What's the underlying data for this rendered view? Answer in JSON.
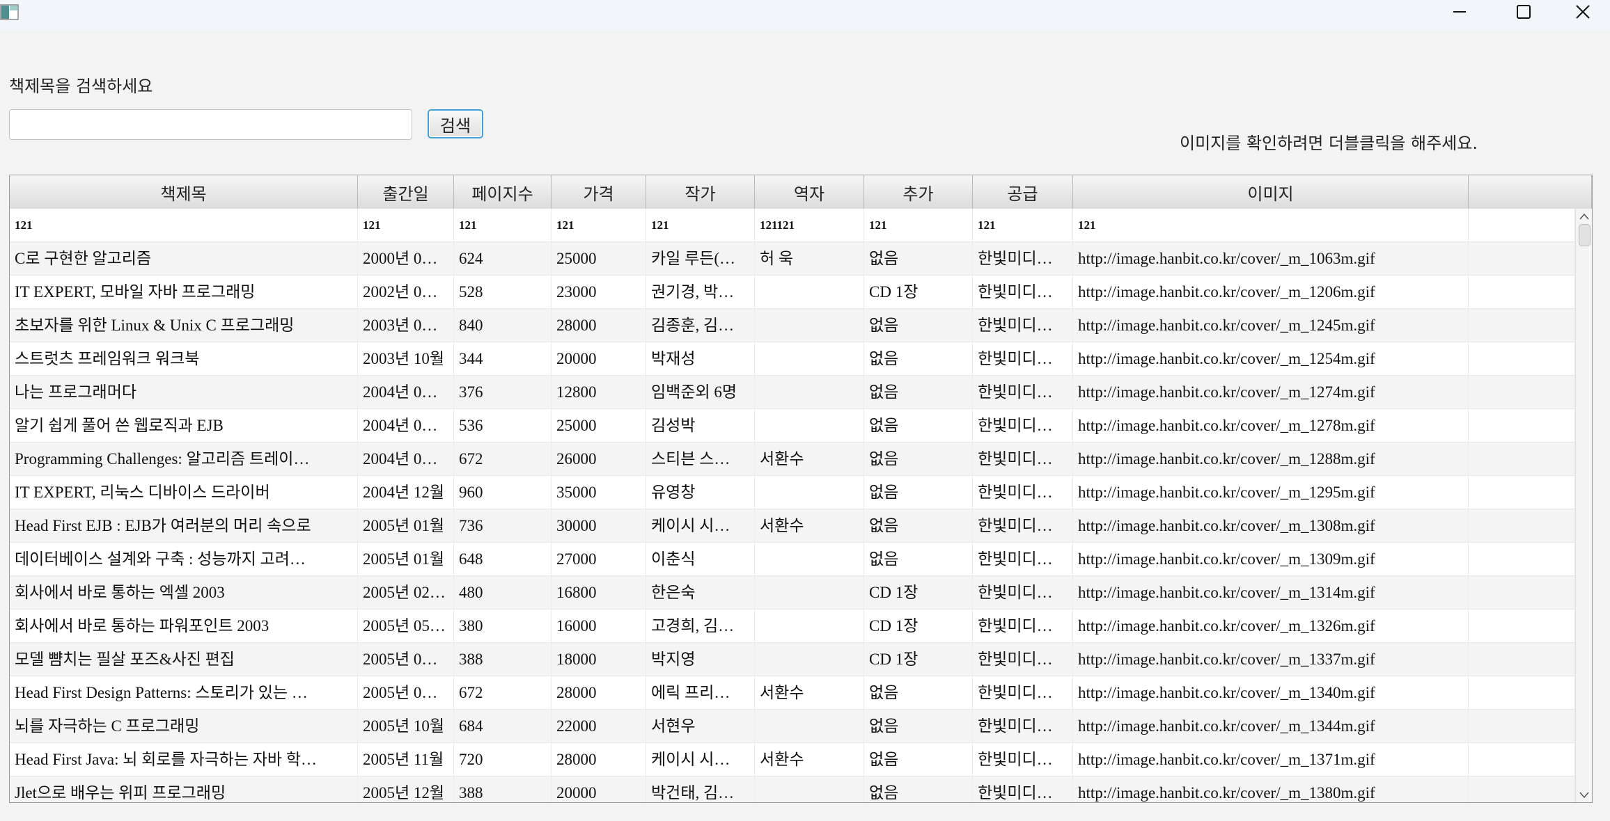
{
  "window": {
    "app_icon": "app-icon",
    "minimize_icon": "minimize-icon",
    "maximize_icon": "maximize-icon",
    "close_icon": "close-icon"
  },
  "search": {
    "label": "책제목을 검색하세요",
    "value": "",
    "button_label": "검색"
  },
  "hint": "이미지를 확인하려면 더블클릭을 해주세요.",
  "table": {
    "columns": [
      "책제목",
      "출간일",
      "페이지수",
      "가격",
      "작가",
      "역자",
      "추가",
      "공급",
      "이미지",
      ""
    ],
    "edit_row": [
      "121",
      "121",
      "121",
      "121",
      "121",
      "121121",
      "121",
      "121",
      "121",
      ""
    ],
    "rows": [
      [
        "C로 구현한 알고리즘",
        "2000년 0…",
        "624",
        "25000",
        "카일 루든(…",
        "허 욱",
        "없음",
        "한빛미디…",
        "http://image.hanbit.co.kr/cover/_m_1063m.gif",
        ""
      ],
      [
        "IT EXPERT, 모바일 자바 프로그래밍",
        "2002년 0…",
        "528",
        "23000",
        "권기경, 박…",
        "",
        "CD 1장",
        "한빛미디…",
        "http://image.hanbit.co.kr/cover/_m_1206m.gif",
        ""
      ],
      [
        "초보자를 위한 Linux & Unix C 프로그래밍",
        "2003년 0…",
        "840",
        "28000",
        "김종훈, 김…",
        "",
        "없음",
        "한빛미디…",
        "http://image.hanbit.co.kr/cover/_m_1245m.gif",
        ""
      ],
      [
        "스트럿츠 프레임워크 워크북",
        "2003년 10월",
        "344",
        "20000",
        "박재성",
        "",
        "없음",
        "한빛미디…",
        "http://image.hanbit.co.kr/cover/_m_1254m.gif",
        ""
      ],
      [
        "나는 프로그래머다",
        "2004년 0…",
        "376",
        "12800",
        "임백준외 6명",
        "",
        "없음",
        "한빛미디…",
        "http://image.hanbit.co.kr/cover/_m_1274m.gif",
        ""
      ],
      [
        "알기 쉽게 풀어 쓴 웹로직과 EJB",
        "2004년 0…",
        "536",
        "25000",
        "김성박",
        "",
        "없음",
        "한빛미디…",
        "http://image.hanbit.co.kr/cover/_m_1278m.gif",
        ""
      ],
      [
        "Programming Challenges: 알고리즘 트레이…",
        "2004년 0…",
        "672",
        "26000",
        "스티븐 스…",
        "서환수",
        "없음",
        "한빛미디…",
        "http://image.hanbit.co.kr/cover/_m_1288m.gif",
        ""
      ],
      [
        "IT EXPERT, 리눅스 디바이스 드라이버",
        "2004년 12월",
        "960",
        "35000",
        "유영창",
        "",
        "없음",
        "한빛미디…",
        "http://image.hanbit.co.kr/cover/_m_1295m.gif",
        ""
      ],
      [
        "Head First EJB : EJB가 여러분의 머리 속으로",
        "2005년 01월",
        "736",
        "30000",
        "케이시 시…",
        "서환수",
        "없음",
        "한빛미디…",
        "http://image.hanbit.co.kr/cover/_m_1308m.gif",
        ""
      ],
      [
        "데이터베이스 설계와 구축 : 성능까지 고려…",
        "2005년 01월",
        "648",
        "27000",
        "이춘식",
        "",
        "없음",
        "한빛미디…",
        "http://image.hanbit.co.kr/cover/_m_1309m.gif",
        ""
      ],
      [
        "회사에서 바로 통하는 엑셀 2003",
        "2005년 02…",
        "480",
        "16800",
        "한은숙",
        "",
        "CD 1장",
        "한빛미디…",
        "http://image.hanbit.co.kr/cover/_m_1314m.gif",
        ""
      ],
      [
        "회사에서 바로 통하는 파워포인트 2003",
        "2005년 05…",
        "380",
        "16000",
        "고경희, 김…",
        "",
        "CD 1장",
        "한빛미디…",
        "http://image.hanbit.co.kr/cover/_m_1326m.gif",
        ""
      ],
      [
        "모델 뺨치는 필살 포즈&사진 편집",
        "2005년 0…",
        "388",
        "18000",
        "박지영",
        "",
        "CD 1장",
        "한빛미디…",
        "http://image.hanbit.co.kr/cover/_m_1337m.gif",
        ""
      ],
      [
        "Head First Design Patterns: 스토리가 있는 …",
        "2005년 0…",
        "672",
        "28000",
        "에릭 프리…",
        "서환수",
        "없음",
        "한빛미디…",
        "http://image.hanbit.co.kr/cover/_m_1340m.gif",
        ""
      ],
      [
        "뇌를 자극하는 C 프로그래밍",
        "2005년 10월",
        "684",
        "22000",
        "서현우",
        "",
        "없음",
        "한빛미디…",
        "http://image.hanbit.co.kr/cover/_m_1344m.gif",
        ""
      ],
      [
        "Head First Java: 뇌 회로를 자극하는 자바 학…",
        "2005년 11월",
        "720",
        "28000",
        "케이시 시…",
        "서환수",
        "없음",
        "한빛미디…",
        "http://image.hanbit.co.kr/cover/_m_1371m.gif",
        ""
      ],
      [
        "Jlet으로 배우는 위피 프로그래밍",
        "2005년 12월",
        "388",
        "20000",
        "박건태, 김…",
        "",
        "없음",
        "한빛미디…",
        "http://image.hanbit.co.kr/cover/_m_1380m.gif",
        ""
      ]
    ]
  }
}
